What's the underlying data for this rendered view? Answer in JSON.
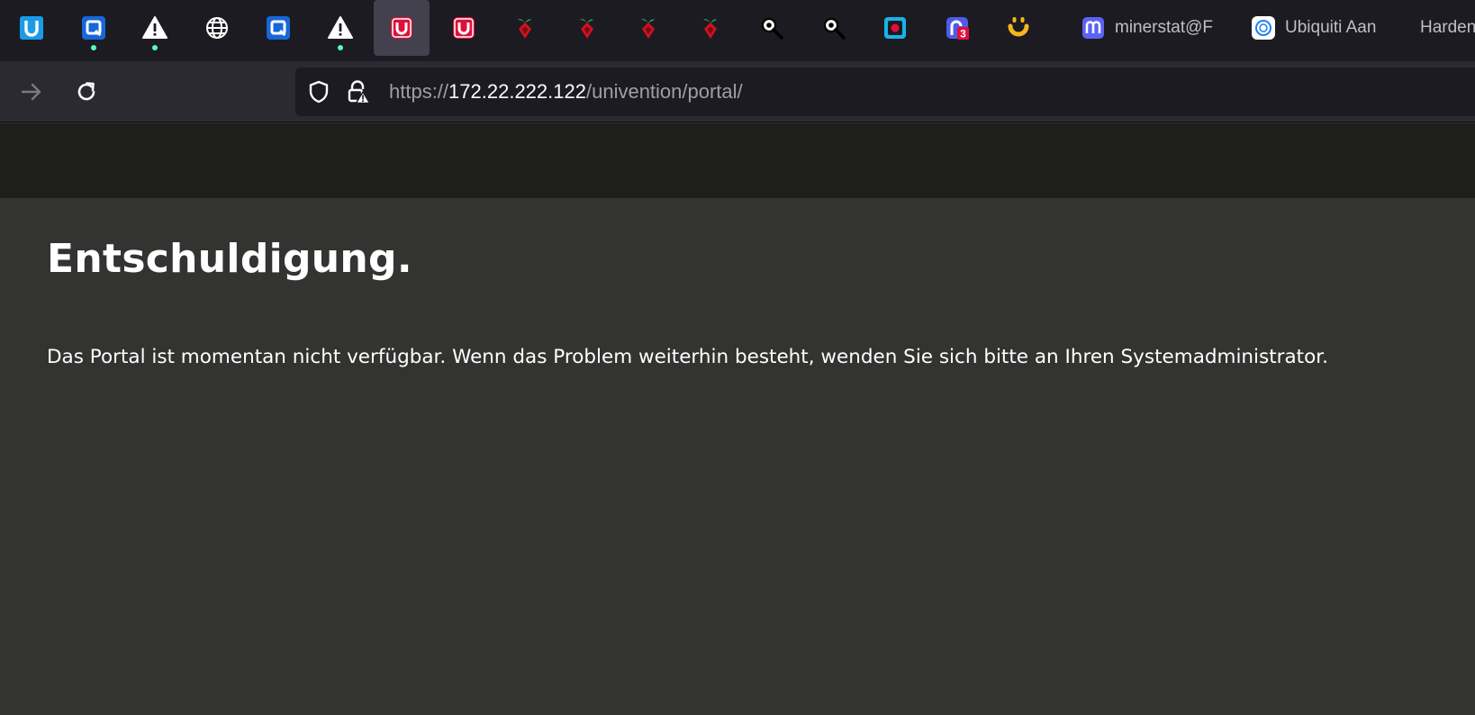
{
  "browser": {
    "tabs": [
      {
        "icon": "univention-icon",
        "color": "#1a9be8",
        "glyph": "U",
        "selected": false,
        "indicator": false
      },
      {
        "icon": "qnap-icon",
        "color": "#1667d8",
        "glyph": "Q",
        "selected": false,
        "indicator": true
      },
      {
        "icon": "warning-icon",
        "color": "#ffffff",
        "glyph": "!",
        "selected": false,
        "indicator": true
      },
      {
        "icon": "globe-icon",
        "color": "#ffffff",
        "glyph": "",
        "selected": false,
        "indicator": false
      },
      {
        "icon": "qnap-icon",
        "color": "#1667d8",
        "glyph": "Q",
        "selected": false,
        "indicator": false
      },
      {
        "icon": "warning-icon",
        "color": "#ffffff",
        "glyph": "!",
        "selected": false,
        "indicator": true
      },
      {
        "icon": "unraid-icon",
        "color": "#e0103c",
        "glyph": "U",
        "selected": true,
        "indicator": false
      },
      {
        "icon": "unraid-icon",
        "color": "#e0103c",
        "glyph": "U",
        "selected": false,
        "indicator": false
      },
      {
        "icon": "pihole-icon",
        "color": "#d3111e",
        "glyph": "",
        "selected": false,
        "indicator": false
      },
      {
        "icon": "pihole-icon",
        "color": "#d3111e",
        "glyph": "",
        "selected": false,
        "indicator": false
      },
      {
        "icon": "pihole-icon",
        "color": "#d3111e",
        "glyph": "",
        "selected": false,
        "indicator": false
      },
      {
        "icon": "pihole-icon",
        "color": "#d3111e",
        "glyph": "",
        "selected": false,
        "indicator": false
      },
      {
        "icon": "magnifier-icon",
        "color": "#ffffff",
        "glyph": "",
        "selected": false,
        "indicator": false
      },
      {
        "icon": "magnifier-icon",
        "color": "#ffffff",
        "glyph": "",
        "selected": false,
        "indicator": false
      },
      {
        "icon": "frame-app-icon",
        "color": "#16b4e8",
        "glyph": "",
        "selected": false,
        "indicator": false
      },
      {
        "icon": "notification-app-icon",
        "color": "#4f5ce8",
        "glyph": "3",
        "selected": false,
        "indicator": false
      },
      {
        "icon": "smiley-app-icon",
        "color": "#f7b51c",
        "glyph": "",
        "selected": false,
        "indicator": false
      }
    ],
    "named_tabs": [
      {
        "icon": "minerstat-icon",
        "color": "#5b63f5",
        "title": "minerstat@F"
      },
      {
        "icon": "ubiquiti-icon",
        "color": "#1c7ff7",
        "title": "Ubiquiti Aan"
      },
      {
        "icon": "",
        "color": "",
        "title": "Harden"
      }
    ],
    "url": {
      "scheme": "https://",
      "host": "172.22.222.122",
      "path": "/univention/portal/"
    }
  },
  "page": {
    "title": "Entschuldigung.",
    "message": "Das Portal ist momentan nicht verfügbar. Wenn das Problem weiterhin besteht, wenden Sie sich bitte an Ihren Systemadministrator."
  }
}
